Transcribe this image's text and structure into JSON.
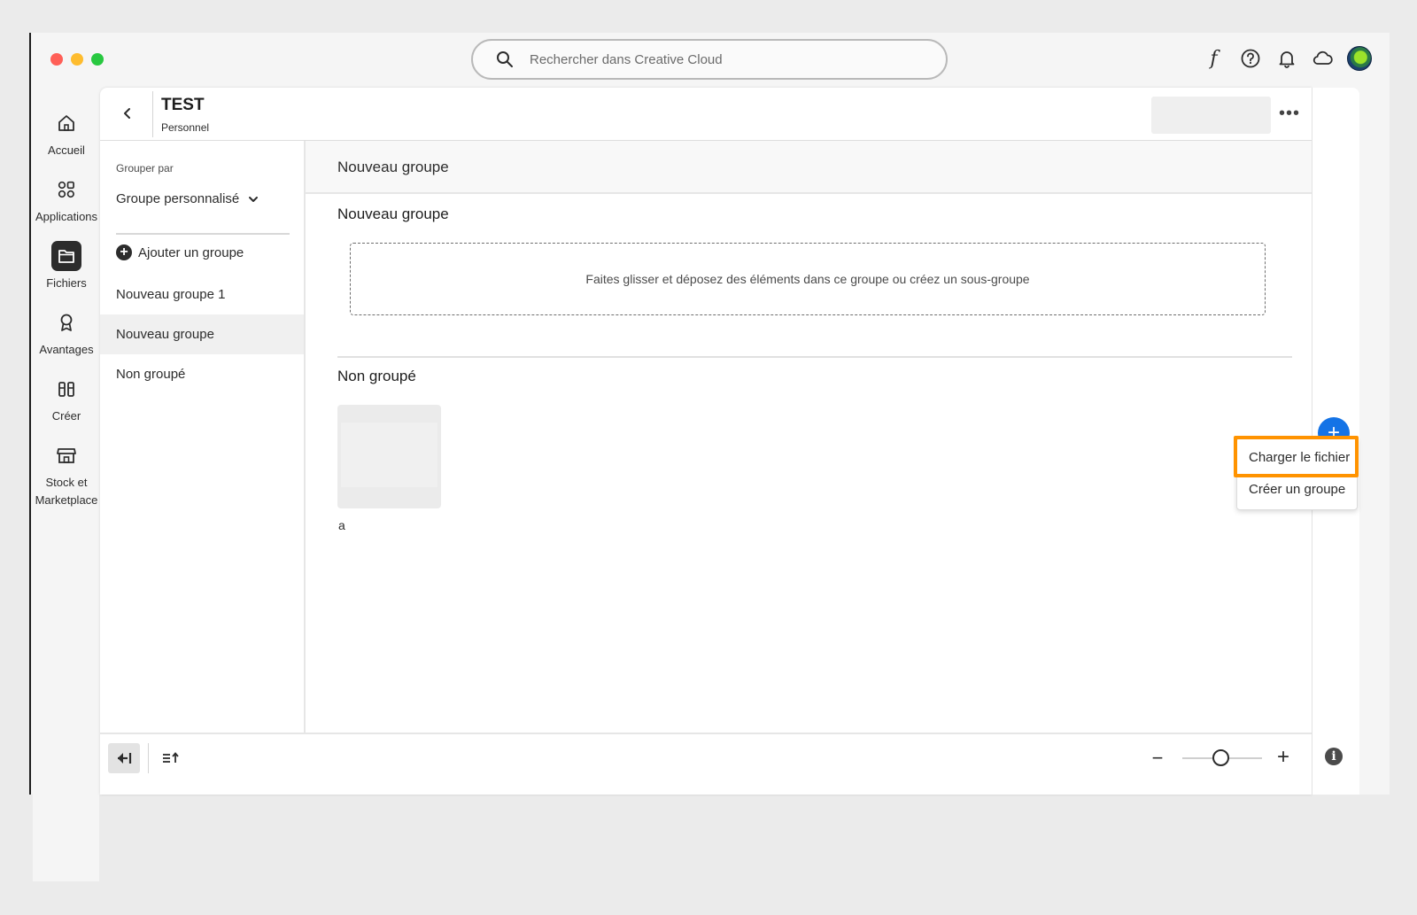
{
  "search": {
    "placeholder": "Rechercher dans Creative Cloud"
  },
  "topbar": {
    "font_icon": "f"
  },
  "sidebar": {
    "items": [
      {
        "label": "Accueil",
        "icon": "home-icon"
      },
      {
        "label": "Applications",
        "icon": "apps-icon"
      },
      {
        "label": "Fichiers",
        "icon": "folder-icon",
        "active": true
      },
      {
        "label": "Avantages",
        "icon": "award-icon"
      },
      {
        "label": "Créer",
        "icon": "create-icon"
      },
      {
        "label": "Stock et Marketplace",
        "icon": "store-icon"
      }
    ]
  },
  "header": {
    "title": "TEST",
    "subtitle": "Personnel",
    "more": "•••"
  },
  "left_panel": {
    "group_by_label": "Grouper par",
    "group_by_value": "Groupe personnalisé",
    "add_group": "Ajouter un groupe",
    "groups": [
      "Nouveau groupe 1",
      "Nouveau groupe",
      "Non groupé"
    ]
  },
  "content": {
    "header_title": "Nouveau groupe",
    "section1_title": "Nouveau groupe",
    "dropzone_text": "Faites glisser et déposez des éléments dans ce groupe ou créez un sous-groupe",
    "section2_title": "Non groupé",
    "file_name": "a"
  },
  "fab_menu": {
    "upload_file": "Charger le fichier",
    "create_group": "Créer un groupe"
  },
  "colors": {
    "accent_blue": "#1473e6",
    "highlight_orange": "#ff9300"
  }
}
